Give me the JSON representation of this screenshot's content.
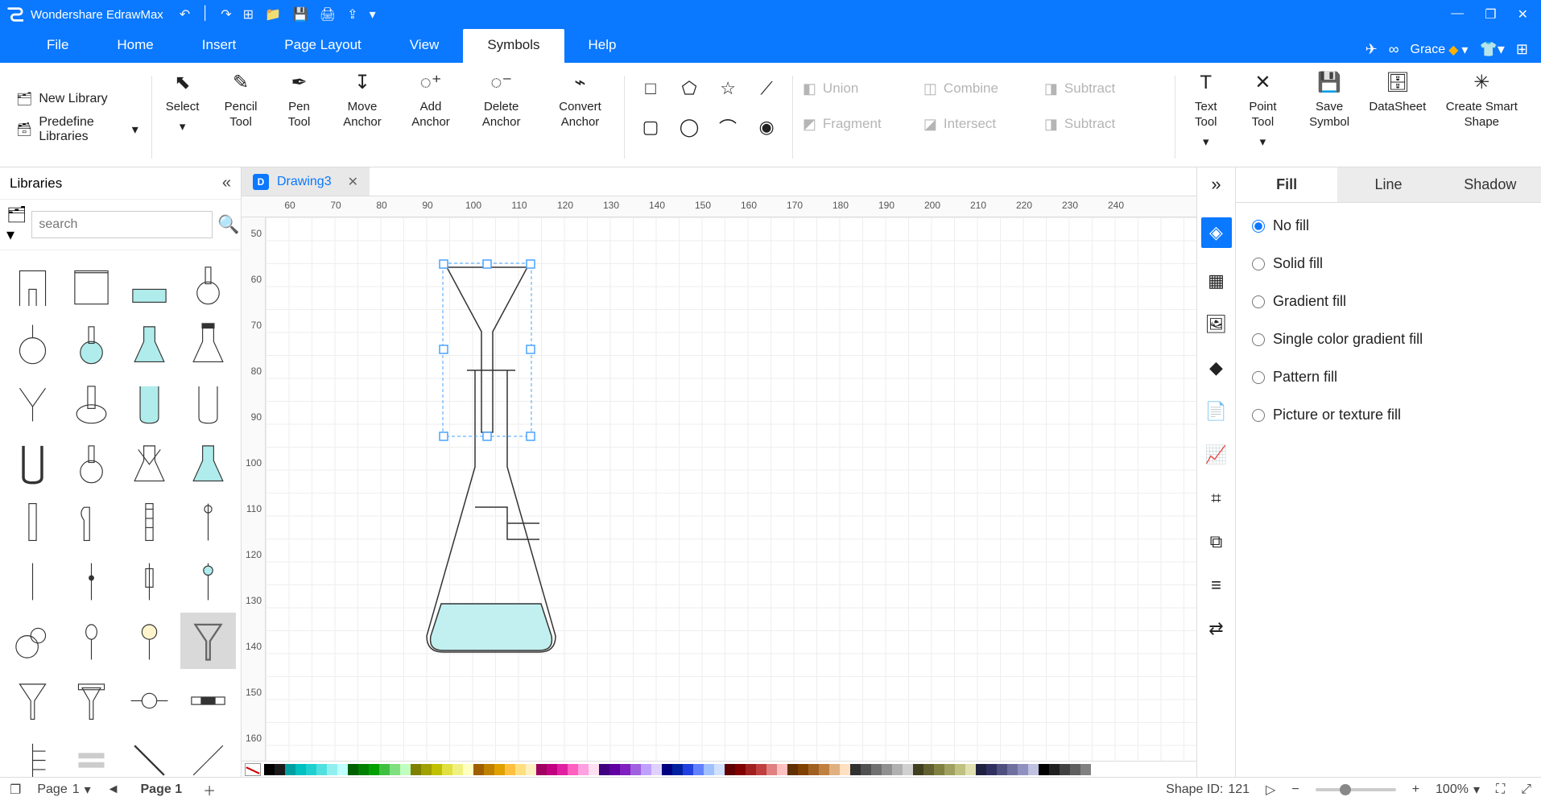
{
  "app": {
    "title": "Wondershare EdrawMax"
  },
  "titlebar_icons": [
    "↶",
    "↷",
    "⊞",
    "📁",
    "💾",
    "🖨",
    "⇪",
    "▾"
  ],
  "window_buttons": [
    "—",
    "❐",
    "✕"
  ],
  "menu": {
    "items": [
      "File",
      "Home",
      "Insert",
      "Page Layout",
      "View",
      "Symbols",
      "Help"
    ],
    "active": "Symbols",
    "user": "Grace"
  },
  "ribbon": {
    "lib_buttons": {
      "new": "New Library",
      "pre": "Predefine Libraries"
    },
    "tools": [
      {
        "icon": "⬉",
        "label": "Select"
      },
      {
        "icon": "✎",
        "label": "Pencil Tool"
      },
      {
        "icon": "✒",
        "label": "Pen Tool"
      },
      {
        "icon": "↧",
        "label": "Move Anchor"
      },
      {
        "icon": "◌⁺",
        "label": "Add Anchor"
      },
      {
        "icon": "◌⁻",
        "label": "Delete Anchor"
      },
      {
        "icon": "⌁",
        "label": "Convert Anchor"
      }
    ],
    "shapes_row1": [
      "□",
      "⬠",
      "☆",
      "⟋"
    ],
    "shapes_row2": [
      "▢",
      "◯",
      "⌒",
      "◉"
    ],
    "booleans": [
      "Union",
      "Combine",
      "Subtract",
      "Fragment",
      "Intersect",
      "Subtract"
    ],
    "right_tools": [
      {
        "icon": "T",
        "label": "Text Tool"
      },
      {
        "icon": "✕",
        "label": "Point Tool"
      },
      {
        "icon": "💾",
        "label": "Save Symbol"
      },
      {
        "icon": "🗄",
        "label": "DataSheet"
      },
      {
        "icon": "✳",
        "label": "Create Smart Shape"
      }
    ]
  },
  "libraries": {
    "title": "Libraries",
    "search_placeholder": "search"
  },
  "document": {
    "tab_name": "Drawing3"
  },
  "ruler_h": [
    60,
    70,
    80,
    90,
    100,
    110,
    120,
    130,
    140,
    150,
    160,
    170,
    180,
    190,
    200,
    210,
    220,
    230,
    240
  ],
  "ruler_v": [
    50,
    60,
    70,
    80,
    90,
    100,
    110,
    120,
    130,
    140,
    150,
    160
  ],
  "props": {
    "tabs": [
      "Fill",
      "Line",
      "Shadow"
    ],
    "active": "Fill",
    "options": [
      "No fill",
      "Solid fill",
      "Gradient fill",
      "Single color gradient fill",
      "Pattern fill",
      "Picture or texture fill"
    ],
    "selected": "No fill"
  },
  "rt_strip": [
    "◈",
    "▦",
    "🖼",
    "◆",
    "📄",
    "📈",
    "⌗",
    "⧉",
    "≡",
    "⇄"
  ],
  "colors": [
    "#000000",
    "#1a1a1a",
    "#00a0a0",
    "#00c0c0",
    "#20d0d0",
    "#50e0e0",
    "#90f0f0",
    "#c0ffff",
    "#006000",
    "#008000",
    "#00a000",
    "#40c040",
    "#80e080",
    "#c0ffc0",
    "#808000",
    "#a0a000",
    "#c0c000",
    "#e0e040",
    "#f0f080",
    "#ffffc0",
    "#a06000",
    "#c08000",
    "#e0a000",
    "#ffc040",
    "#ffe080",
    "#fff0c0",
    "#a00060",
    "#c00080",
    "#e020a0",
    "#ff60c0",
    "#ffa0e0",
    "#ffe0f0",
    "#400080",
    "#6000a0",
    "#8020c0",
    "#a060e0",
    "#c0a0ff",
    "#e0d0ff",
    "#000080",
    "#0020a0",
    "#2040e0",
    "#6080ff",
    "#a0c0ff",
    "#d0e0ff",
    "#600000",
    "#800000",
    "#a02020",
    "#c04040",
    "#e08080",
    "#ffc0c0",
    "#603000",
    "#804000",
    "#a06020",
    "#c08040",
    "#e0b080",
    "#ffe0c0",
    "#303030",
    "#505050",
    "#707070",
    "#909090",
    "#b0b0b0",
    "#d0d0d0",
    "#404020",
    "#606030",
    "#808040",
    "#a0a060",
    "#c0c080",
    "#e0e0b0",
    "#202040",
    "#303060",
    "#505080",
    "#7070a0",
    "#9090c0",
    "#c0c0e0",
    "#000000",
    "#202020",
    "#404040",
    "#606060",
    "#808080",
    "#ffffff"
  ],
  "status": {
    "shape_id_label": "Shape ID:",
    "shape_id_value": "121",
    "page_label": "Page",
    "page_num": "1",
    "page_tab": "Page 1",
    "zoom": "100%"
  }
}
